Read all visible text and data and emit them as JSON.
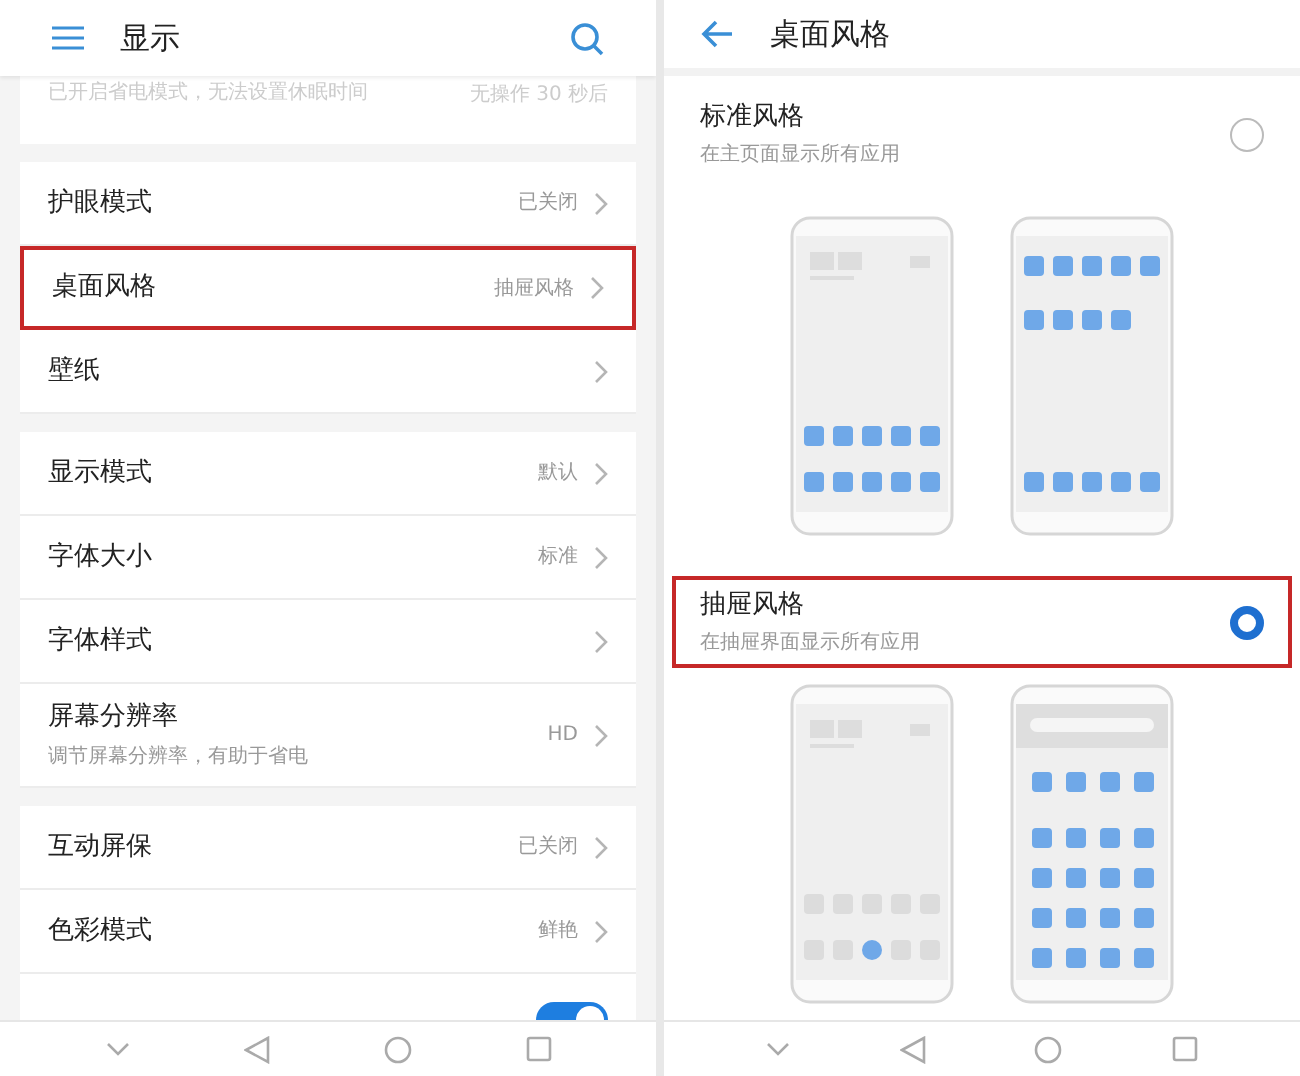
{
  "left": {
    "title": "显示",
    "partial_row": {
      "label": "已开启省电模式，无法设置休眠时间",
      "value": "无操作 30 秒后"
    },
    "groups": [
      [
        {
          "label": "护眼模式",
          "value": "已关闭",
          "highlighted": false
        },
        {
          "label": "桌面风格",
          "value": "抽屉风格",
          "highlighted": true
        },
        {
          "label": "壁纸",
          "highlighted": false
        }
      ],
      [
        {
          "label": "显示模式",
          "value": "默认",
          "highlighted": false
        },
        {
          "label": "字体大小",
          "value": "标准",
          "highlighted": false
        },
        {
          "label": "字体样式",
          "highlighted": false
        },
        {
          "label": "屏幕分辨率",
          "subtitle": "调节屏幕分辨率，有助于省电",
          "value": "HD",
          "highlighted": false
        }
      ],
      [
        {
          "label": "互动屏保",
          "value": "已关闭",
          "highlighted": false
        },
        {
          "label": "色彩模式",
          "value": "鲜艳",
          "highlighted": false
        }
      ]
    ],
    "toggle": {
      "on": true
    }
  },
  "right": {
    "title": "桌面风格",
    "options": [
      {
        "kind": "standard",
        "title": "标准风格",
        "subtitle": "在主页面显示所有应用",
        "selected": false,
        "highlighted": false
      },
      {
        "kind": "drawer",
        "title": "抽屉风格",
        "subtitle": "在抽屉界面显示所有应用",
        "selected": true,
        "highlighted": true
      }
    ]
  }
}
